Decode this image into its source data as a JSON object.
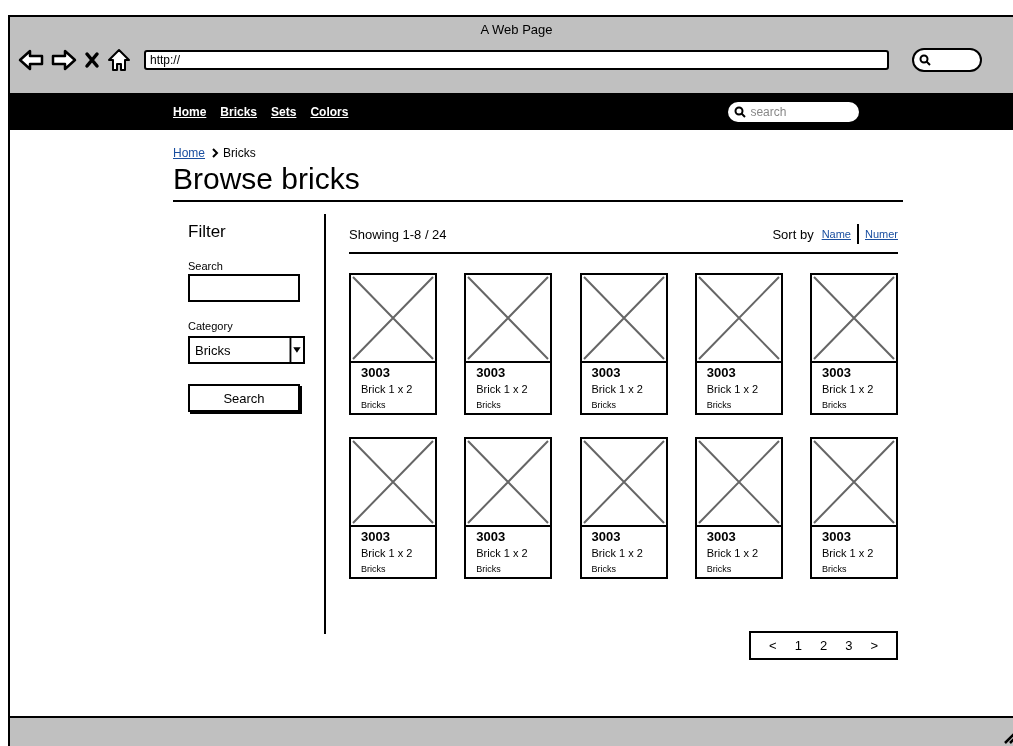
{
  "window": {
    "title": "A Web Page",
    "url": "http://"
  },
  "navbar": {
    "links": [
      "Home",
      "Bricks",
      "Sets",
      "Colors"
    ],
    "search": {
      "placeholder": "search"
    }
  },
  "breadcrumb": {
    "link": "Home",
    "current": "Bricks"
  },
  "heading": "Browse bricks",
  "filter": {
    "title": "Filter",
    "search_label": "Search",
    "category_label": "Category",
    "category_value": "Bricks",
    "button": "Search"
  },
  "results": {
    "summary": "Showing 1-8 / 24",
    "sort_label": "Sort by",
    "sort_links": [
      "Name",
      "Numer"
    ]
  },
  "products": [
    {
      "number": "3003",
      "name": "Brick 1 x 2",
      "category": "Bricks"
    },
    {
      "number": "3003",
      "name": "Brick 1 x 2",
      "category": "Bricks"
    },
    {
      "number": "3003",
      "name": "Brick 1 x 2",
      "category": "Bricks"
    },
    {
      "number": "3003",
      "name": "Brick 1 x 2",
      "category": "Bricks"
    },
    {
      "number": "3003",
      "name": "Brick 1 x 2",
      "category": "Bricks"
    },
    {
      "number": "3003",
      "name": "Brick 1 x 2",
      "category": "Bricks"
    },
    {
      "number": "3003",
      "name": "Brick 1 x 2",
      "category": "Bricks"
    },
    {
      "number": "3003",
      "name": "Brick 1 x 2",
      "category": "Bricks"
    },
    {
      "number": "3003",
      "name": "Brick 1 x 2",
      "category": "Bricks"
    },
    {
      "number": "3003",
      "name": "Brick 1 x 2",
      "category": "Bricks"
    }
  ],
  "pager": [
    "<",
    "1",
    "2",
    "3",
    ">"
  ]
}
